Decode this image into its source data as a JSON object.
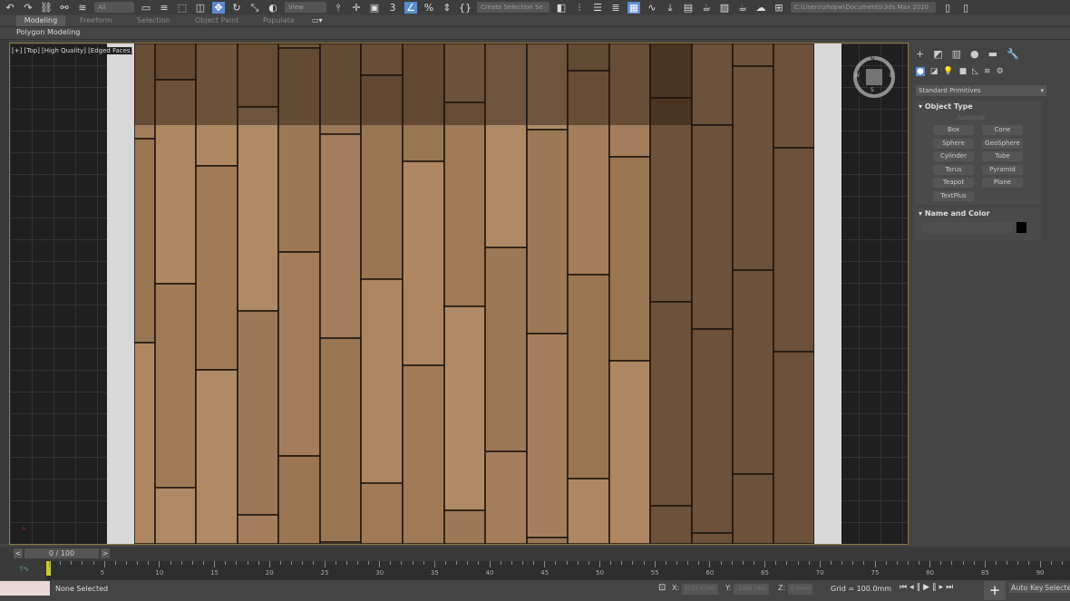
{
  "toolbar": {
    "selection_filter": "All",
    "ref_coord": "View",
    "named_selection": "Create Selection Se",
    "project_path": "C:\\Users\\shopw\\Documents\\3ds Max 2020"
  },
  "ribbon": {
    "tabs": [
      "Modeling",
      "Freeform",
      "Selection",
      "Object Paint",
      "Populate"
    ],
    "active_tab": "Modeling",
    "sub_label": "Polygon Modeling"
  },
  "viewport": {
    "label": "[+] [Top] [High Quality] [Edged Faces]",
    "viewcube_labels": {
      "top": "N",
      "left": "W",
      "right": "E",
      "bottom": "S"
    }
  },
  "command_panel": {
    "category": "Standard Primitives",
    "rollout_object_type": "Object Type",
    "autogrid": "AutoGrid",
    "buttons": [
      "Box",
      "Cone",
      "Sphere",
      "GeoSphere",
      "Cylinder",
      "Tube",
      "Torus",
      "Pyramid",
      "Teapot",
      "Plane",
      "TextPlus"
    ],
    "rollout_name_color": "Name and Color",
    "object_color": "#000000"
  },
  "timeline": {
    "frame_display": "0 / 100",
    "current_frame": 0,
    "ticks": [
      "5",
      "10",
      "15",
      "20",
      "25",
      "30",
      "35",
      "40",
      "45",
      "50",
      "55",
      "60",
      "65",
      "70",
      "75",
      "80",
      "85",
      "90"
    ]
  },
  "status": {
    "selection": "None Selected",
    "x_label": "X:",
    "x_value": "5531.074m",
    "y_label": "Y:",
    "y_value": "-2366.78m",
    "z_label": "Z:",
    "z_value": "0.0mm",
    "grid": "Grid = 100.0mm",
    "auto_key": "Auto Key",
    "selected": "Selected"
  }
}
